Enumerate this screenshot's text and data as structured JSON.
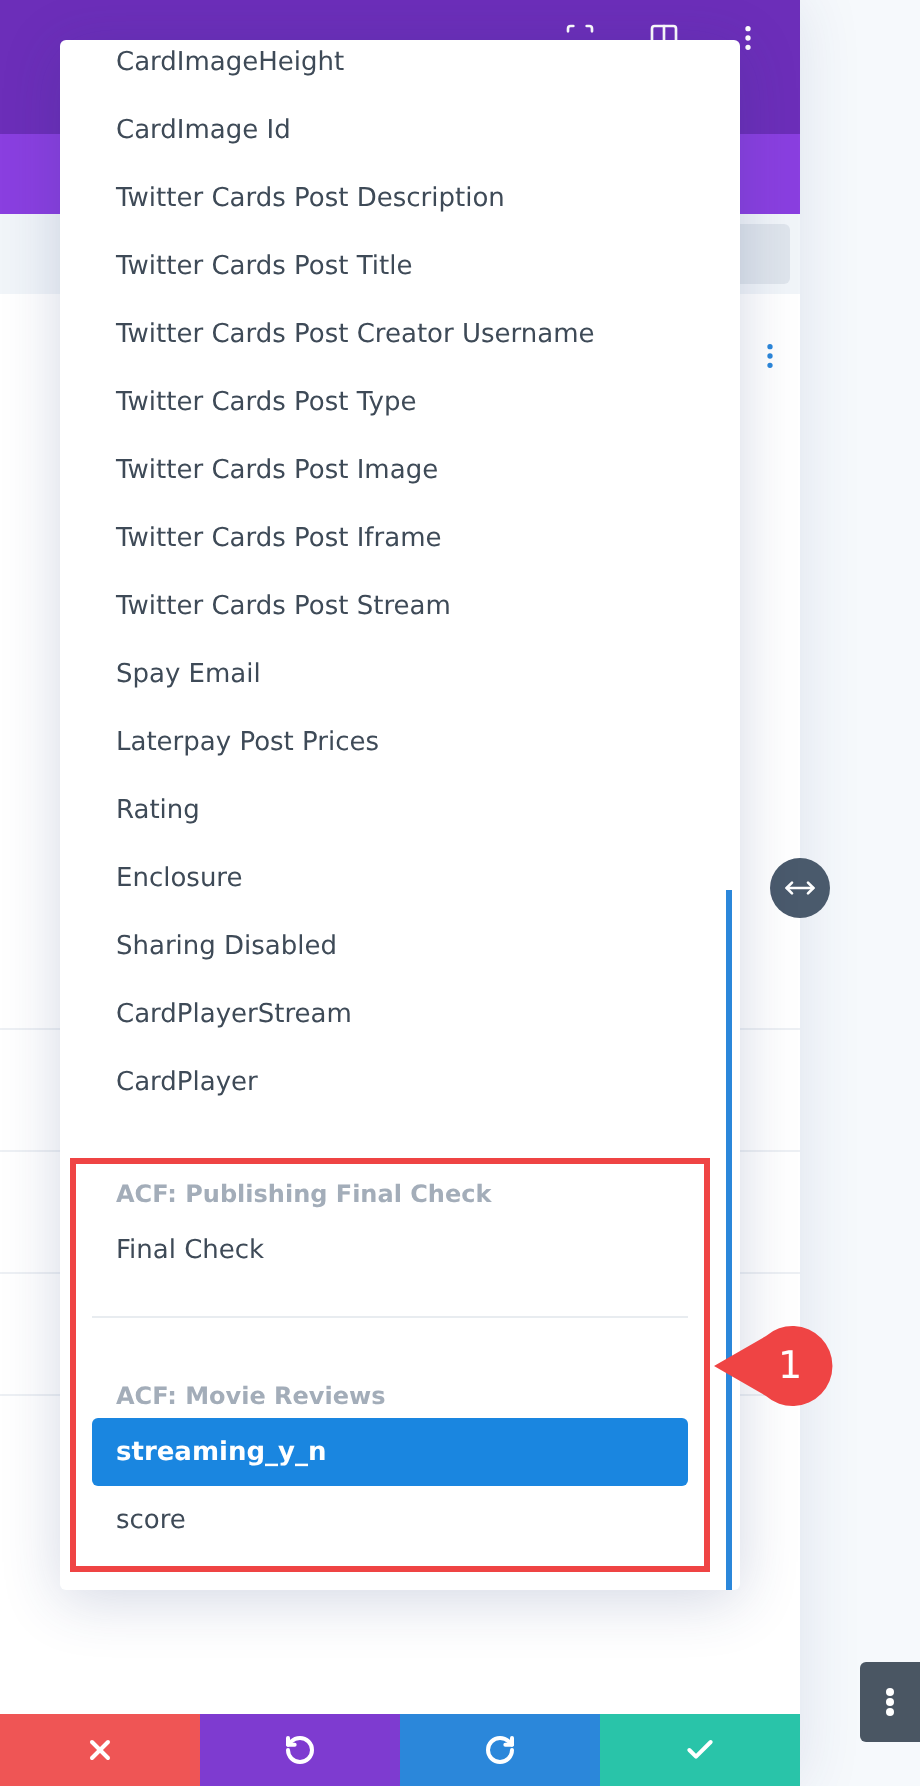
{
  "dropdown": {
    "items": [
      {
        "label": "CardImageHeight",
        "selected": false
      },
      {
        "label": "CardImage Id",
        "selected": false
      },
      {
        "label": "Twitter Cards Post Description",
        "selected": false
      },
      {
        "label": "Twitter Cards Post Title",
        "selected": false
      },
      {
        "label": "Twitter Cards Post Creator Username",
        "selected": false
      },
      {
        "label": "Twitter Cards Post Type",
        "selected": false
      },
      {
        "label": "Twitter Cards Post Image",
        "selected": false
      },
      {
        "label": "Twitter Cards Post Iframe",
        "selected": false
      },
      {
        "label": "Twitter Cards Post Stream",
        "selected": false
      },
      {
        "label": "Spay Email",
        "selected": false
      },
      {
        "label": "Laterpay Post Prices",
        "selected": false
      },
      {
        "label": "Rating",
        "selected": false
      },
      {
        "label": "Enclosure",
        "selected": false
      },
      {
        "label": "Sharing Disabled",
        "selected": false
      },
      {
        "label": "CardPlayerStream",
        "selected": false
      },
      {
        "label": "CardPlayer",
        "selected": false
      }
    ],
    "groups": [
      {
        "heading": "ACF: Publishing Final Check",
        "items": [
          {
            "label": "Final Check",
            "selected": false
          }
        ]
      },
      {
        "heading": "ACF: Movie Reviews",
        "items": [
          {
            "label": "streaming_y_n",
            "selected": true
          },
          {
            "label": "score",
            "selected": false
          }
        ]
      }
    ]
  },
  "annotation": {
    "number": "1"
  },
  "actions": [
    {
      "kind": "cancel"
    },
    {
      "kind": "undo"
    },
    {
      "kind": "redo"
    },
    {
      "kind": "save"
    }
  ]
}
